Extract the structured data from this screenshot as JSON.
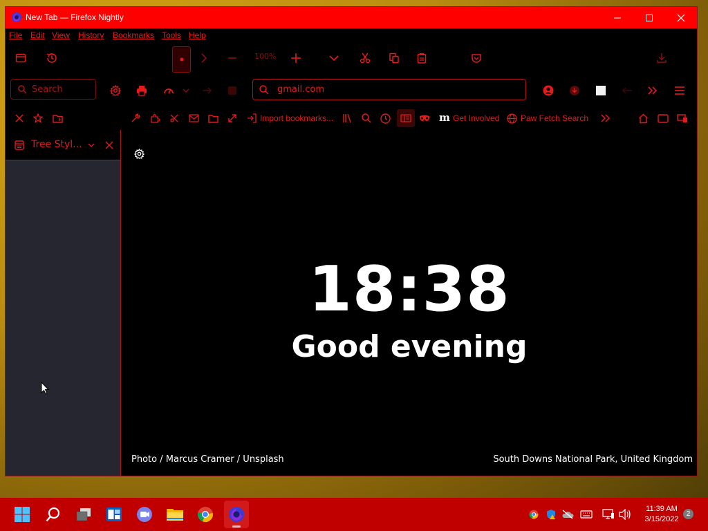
{
  "window": {
    "title": "New Tab — Firefox Nightly",
    "accent_color": "#ff0000",
    "icon_color": "#e51a1a"
  },
  "menu": {
    "file": "File",
    "edit": "Edit",
    "view": "View",
    "history": "History",
    "bookmarks": "Bookmarks",
    "tools": "Tools",
    "help": "Help"
  },
  "toolbar1": {
    "zoom_label": "100%",
    "icons": [
      "sidebar-icon",
      "history-icon",
      "record-icon",
      "forward-icon",
      "zoom-out-icon",
      "zoom-in-icon",
      "chevron-down-icon",
      "cut-icon",
      "copy-icon",
      "paste-icon",
      "pocket-icon",
      "download-icon"
    ]
  },
  "toolbar2": {
    "search_placeholder": "Search",
    "url_value": "gmail.com",
    "icons": [
      "gear-icon",
      "print-icon",
      "back-history-icon",
      "new-tab-icon",
      "screenshot-icon",
      "search-icon",
      "account-icon",
      "extension-icon",
      "square-icon",
      "back-icon",
      "overflow-icon",
      "menu-icon"
    ]
  },
  "bookmarks_bar": {
    "import_label": "Import bookmarks...",
    "get_involved_label": "Get Involved",
    "paw_fetch_label": "Paw Fetch Search",
    "m_label": "m"
  },
  "sidebar": {
    "title": "Tree Styl...",
    "body_color": "#262630"
  },
  "newtab": {
    "clock": "18:38",
    "greeting": "Good evening",
    "photo_credit": "Photo / Marcus Cramer / Unsplash",
    "location": "South Downs National Park, United Kingdom"
  },
  "taskbar": {
    "time": "11:39 AM",
    "date": "3/15/2022",
    "notification_count": "2",
    "color": "#c00000"
  }
}
